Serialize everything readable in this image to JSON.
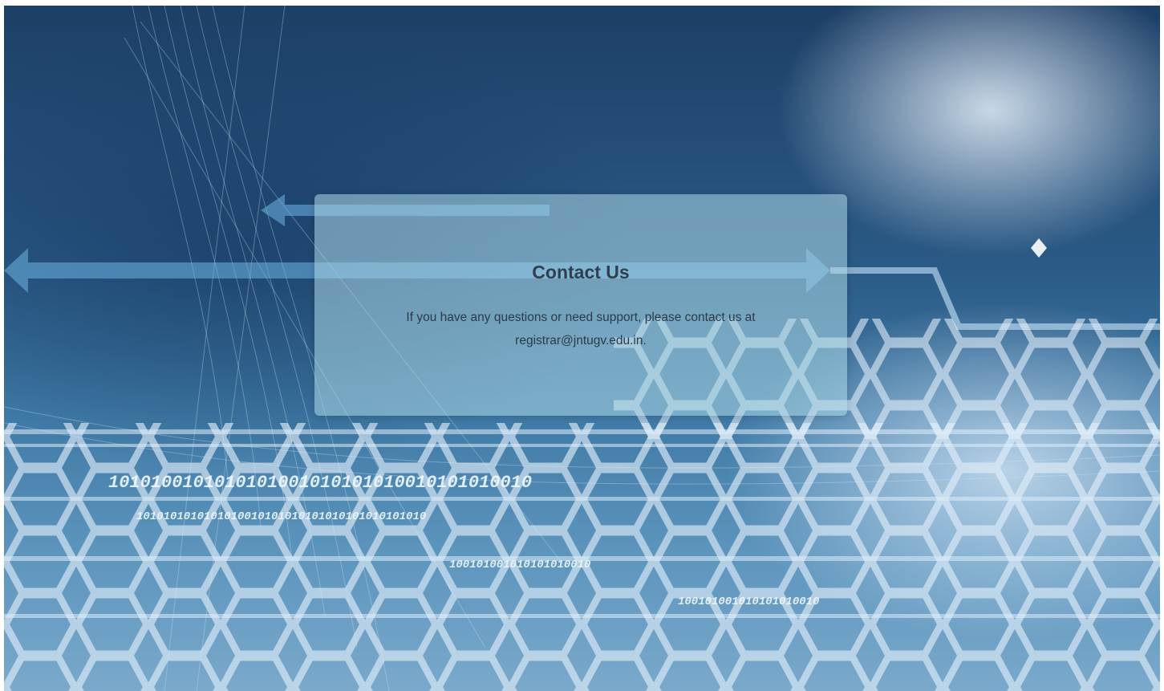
{
  "contact": {
    "title": "Contact Us",
    "message": "If you have any questions or need support, please contact us at",
    "email": "registrar@jntugv.edu.in",
    "suffix": "."
  },
  "background": {
    "binary_lines": [
      "1010100101010101001010101010010101010010",
      "1010101010101010010101010101010101010101010",
      "100101001010101010010",
      "100101001010101010010"
    ]
  },
  "colors": {
    "card": "#add8e6",
    "title": "#2f3e50",
    "text": "#2c3a4a",
    "bg_dark": "#1d3f66",
    "bg_light": "#7aa9cb"
  }
}
